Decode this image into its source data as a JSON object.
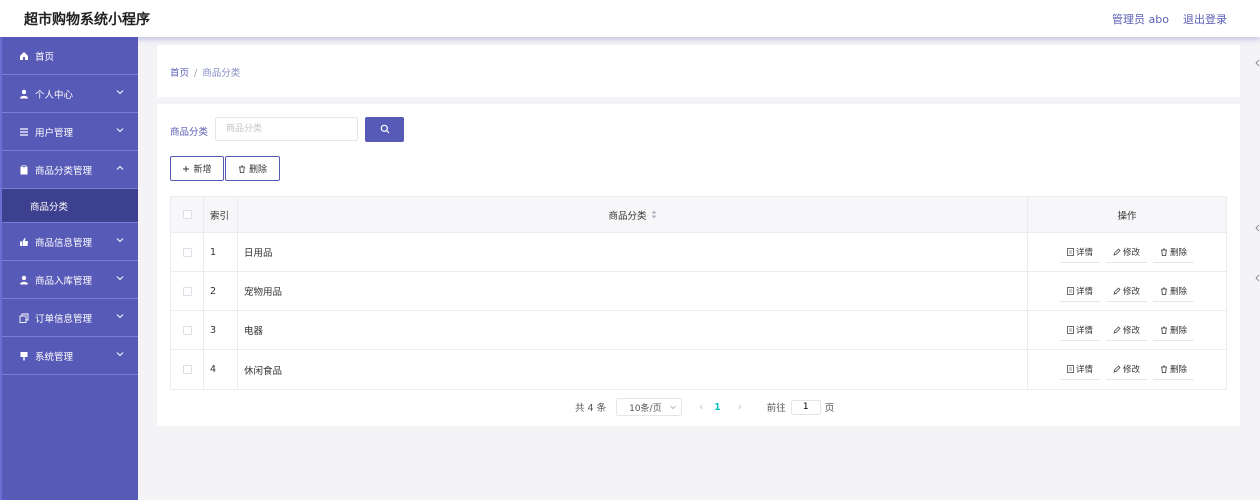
{
  "header": {
    "app_title": "超市购物系统小程序",
    "user_label": "管理员 abo",
    "logout_label": "退出登录"
  },
  "sidebar": {
    "items": [
      {
        "label": "首页",
        "icon": "home-icon",
        "has_chevron": false
      },
      {
        "label": "个人中心",
        "icon": "user-icon",
        "has_chevron": true
      },
      {
        "label": "用户管理",
        "icon": "menu-icon",
        "has_chevron": true
      },
      {
        "label": "商品分类管理",
        "icon": "clipboard-icon",
        "has_chevron": true,
        "expanded": true
      },
      {
        "label": "商品信息管理",
        "icon": "thumbs-icon",
        "has_chevron": true
      },
      {
        "label": "商品入库管理",
        "icon": "user-icon",
        "has_chevron": true
      },
      {
        "label": "订单信息管理",
        "icon": "copy-icon",
        "has_chevron": true
      },
      {
        "label": "系统管理",
        "icon": "pin-icon",
        "has_chevron": true
      }
    ],
    "submenu": {
      "label": "商品分类"
    }
  },
  "breadcrumb": {
    "home": "首页",
    "separator": "/",
    "current": "商品分类"
  },
  "search": {
    "label": "商品分类",
    "placeholder": "商品分类",
    "button_icon": "search-icon"
  },
  "toolbar": {
    "add_label": "新增",
    "delete_label": "删除"
  },
  "table": {
    "headers": {
      "index": "索引",
      "name": "商品分类",
      "ops": "操作"
    },
    "rows": [
      {
        "index": "1",
        "name": "日用品"
      },
      {
        "index": "2",
        "name": "宠物用品"
      },
      {
        "index": "3",
        "name": "电器"
      },
      {
        "index": "4",
        "name": "休闲食品"
      }
    ],
    "ops": {
      "detail": "详情",
      "edit": "修改",
      "delete": "删除"
    }
  },
  "pagination": {
    "total": "共 4 条",
    "page_size": "10条/页",
    "current_page": "1",
    "goto_prefix": "前往",
    "goto_value": "1",
    "goto_suffix": "页"
  },
  "colors": {
    "primary": "#585ab8",
    "active_sub": "#3d3f8f",
    "page_active": "#13c2c2"
  }
}
